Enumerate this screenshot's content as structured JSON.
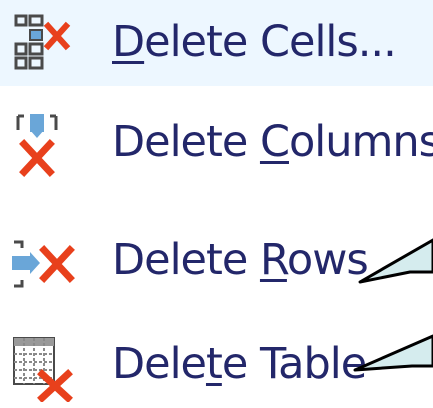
{
  "menu": {
    "items": [
      {
        "id": "delete-cells",
        "label_before": "",
        "accesskey": "D",
        "label_after": "elete Cells...",
        "icon": "delete-cells-icon"
      },
      {
        "id": "delete-columns",
        "label_before": "Delete ",
        "accesskey": "C",
        "label_after": "olumns",
        "icon": "delete-columns-icon"
      },
      {
        "id": "delete-rows",
        "label_before": "Delete ",
        "accesskey": "R",
        "label_after": "ows",
        "icon": "delete-rows-icon"
      },
      {
        "id": "delete-table",
        "label_before": "Dele",
        "accesskey": "t",
        "label_after": "e Table",
        "icon": "delete-table-icon"
      }
    ]
  },
  "colors": {
    "label_text": "#23276a",
    "delete_red": "#e8401c",
    "icon_gray": "#4a4a4a",
    "icon_blue": "#6aa6d8",
    "callout_fill": "#d5ecee",
    "callout_stroke": "#000000"
  }
}
